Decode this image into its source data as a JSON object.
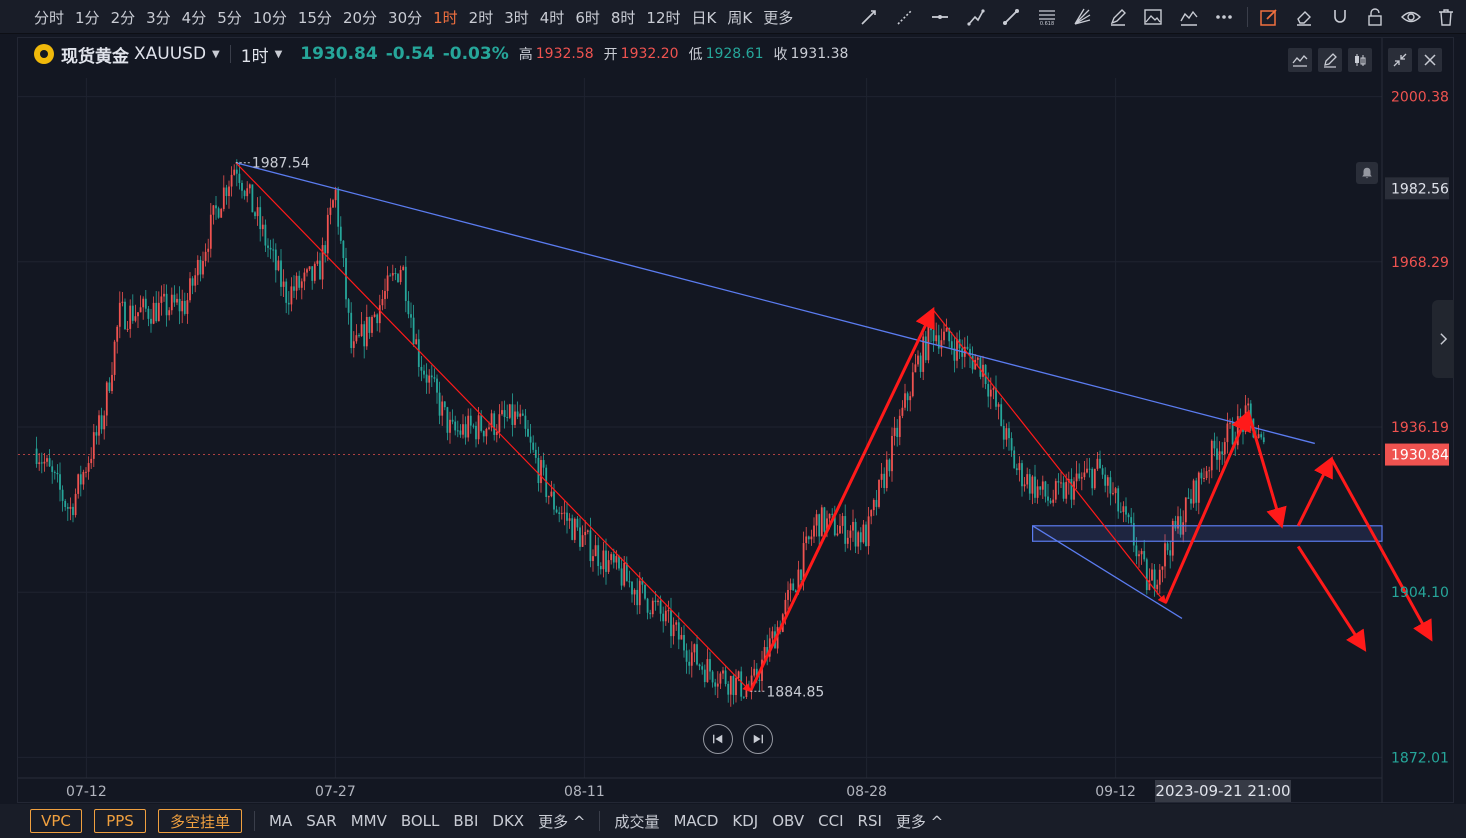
{
  "toolbar": {
    "periods": [
      "分时",
      "1分",
      "2分",
      "3分",
      "4分",
      "5分",
      "10分",
      "15分",
      "20分",
      "30分",
      "1时",
      "2时",
      "3时",
      "4时",
      "6时",
      "8时",
      "12时",
      "日K",
      "周K",
      "更多"
    ],
    "active_period": "1时"
  },
  "header": {
    "symbol_name": "现货黄金",
    "symbol_code": "XAUUSD",
    "period": "1时",
    "last": "1930.84",
    "change": "-0.54",
    "change_pct": "-0.03%",
    "high_label": "高",
    "high": "1932.58",
    "open_label": "开",
    "open": "1932.20",
    "low_label": "低",
    "low": "1928.61",
    "close_label": "收",
    "close": "1931.38"
  },
  "crosshair_date": "2023-09-21 21:00",
  "bottom": {
    "tags": [
      "VPC",
      "PPS",
      "多空挂单"
    ],
    "indicators_main": [
      "MA",
      "SAR",
      "MMV",
      "BOLL",
      "BBI",
      "DKX",
      "更多 ^"
    ],
    "indicators_sub": [
      "成交量",
      "MACD",
      "KDJ",
      "OBV",
      "CCI",
      "RSI",
      "更多 ^"
    ]
  },
  "colors": {
    "up": "#ef5350",
    "down": "#26a69a",
    "trend": "#5b7cf0",
    "arrow": "#ff1a1a",
    "last": "#ef5350",
    "accent": "#f0703f"
  },
  "chart_data": {
    "type": "candlestick",
    "ylim": [
      1868,
      2004
    ],
    "y_ticks": [
      "2000.38",
      "1968.29",
      "1936.19",
      "1904.10",
      "1872.01"
    ],
    "y_tick_values": [
      2000.38,
      1968.29,
      1936.19,
      1904.1,
      1872.01
    ],
    "x_ticks": [
      "07-12",
      "07-27",
      "08-11",
      "08-28",
      "09-12"
    ],
    "hover_price_label": "1982.56",
    "hover_price": 1982.56,
    "last_price_label": "1930.84",
    "last_price": 1930.84,
    "price_path": [
      [
        "07-09",
        1932
      ],
      [
        "07-11",
        1920
      ],
      [
        "07-13",
        1938
      ],
      [
        "07-14",
        1958
      ],
      [
        "07-18",
        1960
      ],
      [
        "07-20",
        1980
      ],
      [
        "07-21",
        1987.54
      ],
      [
        "07-24",
        1962
      ],
      [
        "07-26",
        1966
      ],
      [
        "07-27",
        1982
      ],
      [
        "07-28",
        1950
      ],
      [
        "07-31",
        1968
      ],
      [
        "08-01",
        1950
      ],
      [
        "08-03",
        1935
      ],
      [
        "08-07",
        1938
      ],
      [
        "08-09",
        1922
      ],
      [
        "08-11",
        1914
      ],
      [
        "08-15",
        1902
      ],
      [
        "08-18",
        1890
      ],
      [
        "08-21",
        1884.85
      ],
      [
        "08-23",
        1900
      ],
      [
        "08-25",
        1918
      ],
      [
        "08-28",
        1915
      ],
      [
        "08-31",
        1948
      ],
      [
        "09-01",
        1955
      ],
      [
        "09-04",
        1948
      ],
      [
        "09-06",
        1928
      ],
      [
        "09-08",
        1922
      ],
      [
        "09-11",
        1928
      ],
      [
        "09-13",
        1915
      ],
      [
        "09-14",
        1905
      ],
      [
        "09-15",
        1912
      ],
      [
        "09-18",
        1932
      ],
      [
        "09-20",
        1938
      ],
      [
        "09-21",
        1930.84
      ]
    ],
    "annotations": [
      {
        "text": "1987.54",
        "x": "07-21",
        "y": 1987.54
      },
      {
        "text": "1884.85",
        "x": "08-21",
        "y": 1884.85
      }
    ],
    "trendlines": [
      {
        "from": [
          "07-21",
          1987.54
        ],
        "to": [
          "09-24",
          1933
        ]
      },
      {
        "from": [
          "09-07",
          1917
        ],
        "to": [
          "09-16",
          1899
        ]
      }
    ],
    "support_zone": {
      "x_from": "09-07",
      "low": 1914,
      "high": 1917
    },
    "arrows": [
      {
        "from": [
          "07-21",
          1987.54
        ],
        "to": [
          "08-21",
          1884.85
        ]
      },
      {
        "from": [
          "08-21",
          1884.85
        ],
        "to": [
          "09-01",
          1959
        ]
      },
      {
        "from": [
          "09-01",
          1959
        ],
        "to": [
          "09-15",
          1902
        ]
      },
      {
        "from": [
          "09-15",
          1902
        ],
        "to": [
          "09-20",
          1939
        ]
      },
      {
        "from": [
          "09-20",
          1939
        ],
        "to": [
          "09-22",
          1917
        ]
      },
      {
        "from": [
          "09-23",
          1917
        ],
        "to": [
          "09-25",
          1930
        ]
      },
      {
        "from": [
          "09-23",
          1913
        ],
        "to": [
          "09-27",
          1893
        ]
      },
      {
        "from": [
          "09-25",
          1930
        ],
        "to": [
          "10-01",
          1895
        ]
      }
    ]
  }
}
